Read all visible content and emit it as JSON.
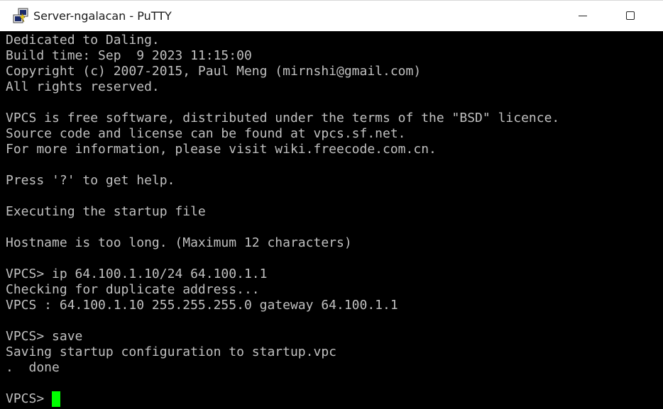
{
  "window": {
    "title": "Server-ngalacan - PuTTY",
    "app_icon": "putty-icon"
  },
  "controls": {
    "minimize_icon": "minimize-icon",
    "maximize_icon": "maximize-icon"
  },
  "terminal": {
    "lines": [
      "Dedicated to Daling.",
      "Build time: Sep  9 2023 11:15:00",
      "Copyright (c) 2007-2015, Paul Meng (mirnshi@gmail.com)",
      "All rights reserved.",
      "",
      "VPCS is free software, distributed under the terms of the \"BSD\" licence.",
      "Source code and license can be found at vpcs.sf.net.",
      "For more information, please visit wiki.freecode.com.cn.",
      "",
      "Press '?' to get help.",
      "",
      "Executing the startup file",
      "",
      "Hostname is too long. (Maximum 12 characters)",
      "",
      "VPCS> ip 64.100.1.10/24 64.100.1.1",
      "Checking for duplicate address...",
      "VPCS : 64.100.1.10 255.255.255.0 gateway 64.100.1.1",
      "",
      "VPCS> save",
      "Saving startup configuration to startup.vpc",
      ".  done",
      ""
    ],
    "prompt": "VPCS> ",
    "text_color": "#c0c0c0",
    "background_color": "#000000",
    "cursor_color": "#00ff00"
  }
}
